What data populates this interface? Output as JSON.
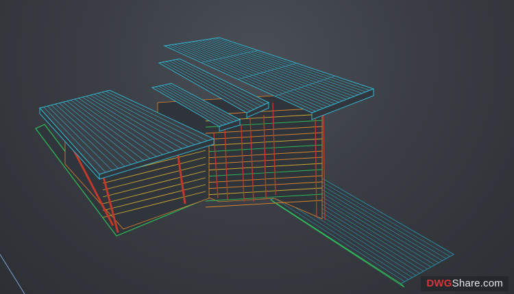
{
  "viewport": {
    "background": "#3a3e44",
    "colors": {
      "plank": "#33b8d4",
      "frame": "#e0882b",
      "post": "#c0392b",
      "rail": "#d6b030",
      "base": "#2fbf5a",
      "deck": "#2a8fa8",
      "axis": "#7fa7d8"
    }
  },
  "watermark": {
    "part_a": "DWG",
    "part_b": "Share.com"
  }
}
